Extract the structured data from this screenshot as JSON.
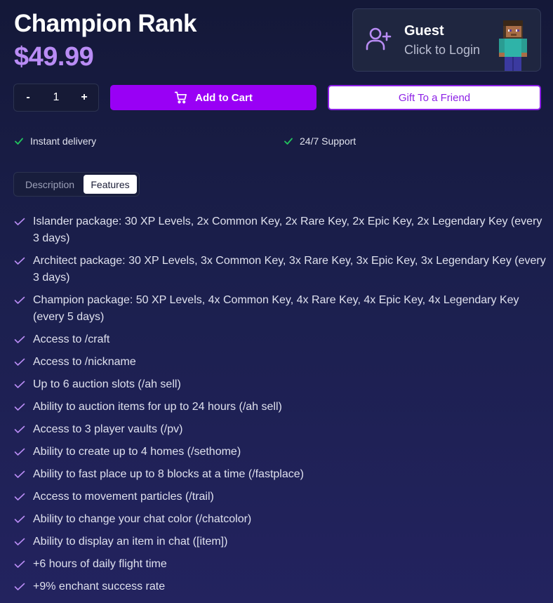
{
  "product": {
    "title": "Champion Rank",
    "price": "$49.99"
  },
  "account": {
    "name": "Guest",
    "action": "Click to Login"
  },
  "cart": {
    "decrement_label": "-",
    "quantity": "1",
    "increment_label": "+",
    "add_to_cart_label": "Add to Cart",
    "gift_label": "Gift To a Friend"
  },
  "perks": [
    "Instant delivery",
    "24/7 Support"
  ],
  "tabs": [
    {
      "label": "Description",
      "active": false
    },
    {
      "label": "Features",
      "active": true
    }
  ],
  "features": [
    "Islander package: 30 XP Levels, 2x Common Key, 2x Rare Key, 2x Epic Key, 2x Legendary Key (every 3 days)",
    "Architect package: 30 XP Levels, 3x Common Key, 3x Rare Key, 3x Epic Key, 3x Legendary Key (every 3 days)",
    "Champion package: 50 XP Levels, 4x Common Key, 4x Rare Key, 4x Epic Key, 4x Legendary Key (every 5 days)",
    "Access to /craft",
    "Access to /nickname",
    "Up to 6 auction slots (/ah sell)",
    "Ability to auction items for up to 24 hours (/ah sell)",
    "Access to 3 player vaults (/pv)",
    "Ability to create up to 4 homes (/sethome)",
    "Ability to fast place up to 8 blocks at a time (/fastplace)",
    "Access to movement particles (/trail)",
    "Ability to change your chat color (/chatcolor)",
    "Ability to display an item in chat ([item])",
    "+6 hours of daily flight time",
    "+9% enchant success rate"
  ],
  "colors": {
    "accent": "#9900f5",
    "price": "#b98cf5",
    "check_perk": "#22c55e",
    "check_feature": "#b98cf5"
  }
}
